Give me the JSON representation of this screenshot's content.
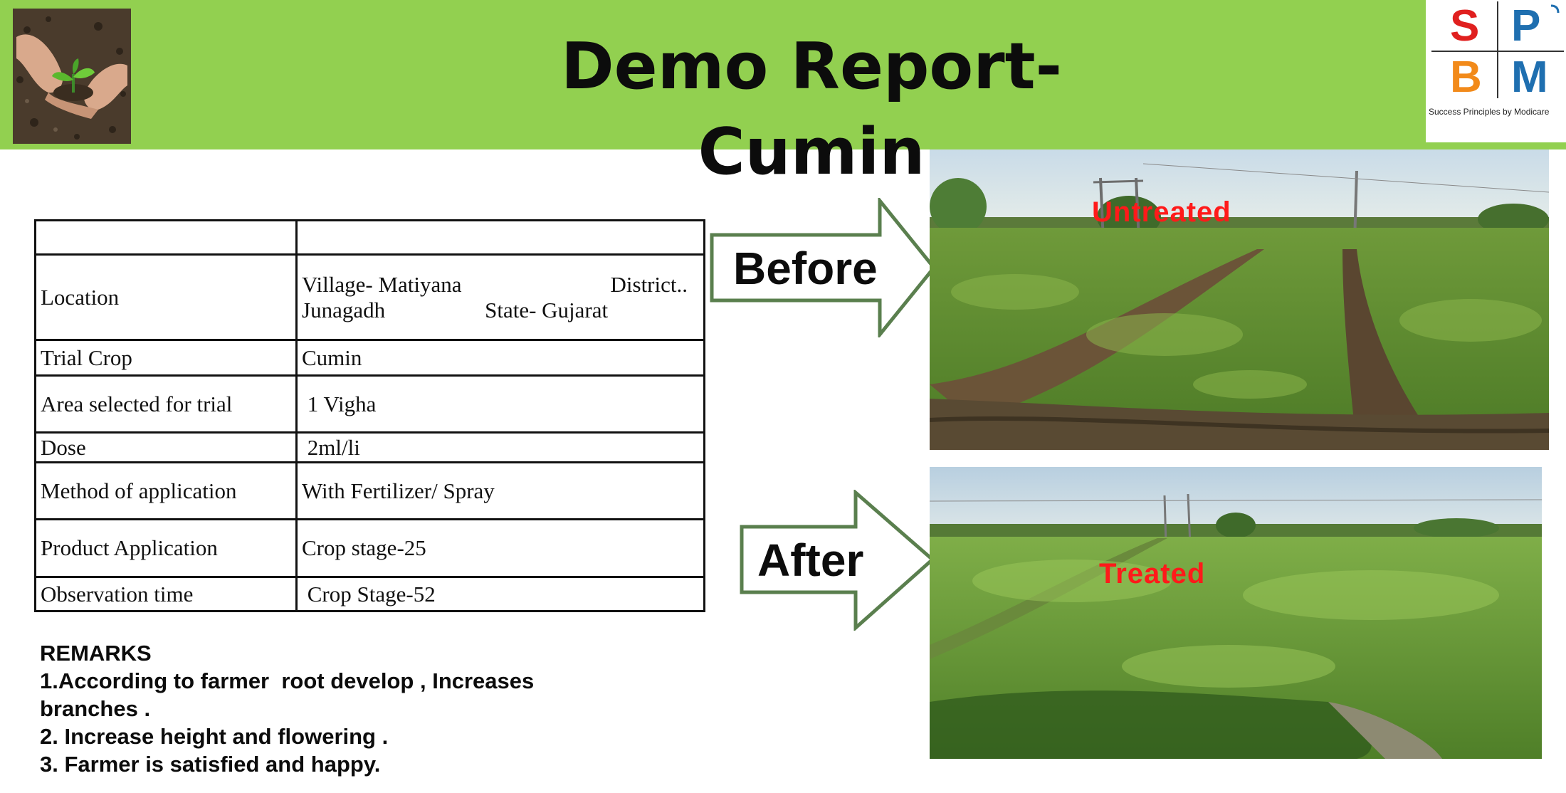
{
  "header": {
    "title": "Demo Report- Cumin",
    "logo_left": "hands-seedling-logo",
    "logo_right": {
      "letters": [
        "S",
        "P",
        "B",
        "M"
      ],
      "tagline": "Success Principles by Modicare",
      "colors": {
        "S": "#e0201f",
        "P": "#1f6fb0",
        "B": "#f28a1a",
        "M": "#1f6fb0"
      }
    }
  },
  "table": {
    "header_row": [
      "",
      ""
    ],
    "rows": [
      {
        "label": "Location",
        "value_line1_a": "Village- Matiyana",
        "value_line1_b": "District..",
        "value_line2_a": "Junagadh",
        "value_line2_b": "State- Gujarat"
      },
      {
        "label": "Trial Crop",
        "value": "Cumin"
      },
      {
        "label": "Area selected for trial",
        "value": " 1 Vigha"
      },
      {
        "label": "Dose",
        "value": " 2ml/li"
      },
      {
        "label": "Method of application",
        "value": "With Fertilizer/ Spray"
      },
      {
        "label": "Product Application",
        "value": "Crop stage-25"
      },
      {
        "label": "Observation time",
        "value": " Crop Stage-52"
      }
    ]
  },
  "remarks": {
    "heading": "REMARKS",
    "items": [
      "1.According to farmer  root develop , Increases",
      "branches .",
      "2. Increase height and flowering .",
      "3. Farmer is satisfied and happy."
    ]
  },
  "comparison": {
    "before": {
      "arrow_label": "Before",
      "photo_label": "Untreated"
    },
    "after": {
      "arrow_label": "After",
      "photo_label": "Treated"
    }
  },
  "colors": {
    "banner": "#92d050",
    "arrow_border": "#5a7f4e",
    "photo_label": "#ff1a1a"
  }
}
